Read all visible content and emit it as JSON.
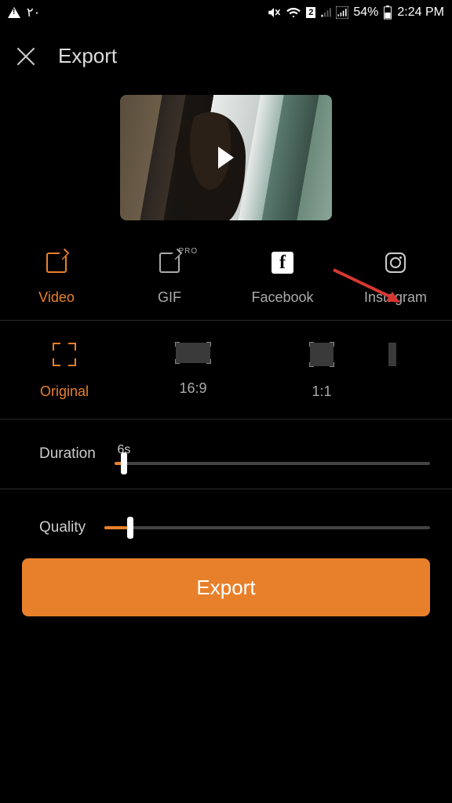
{
  "status": {
    "left_text": "٢٠",
    "battery": "54%",
    "time": "2:24 PM",
    "sim": "2"
  },
  "header": {
    "title": "Export"
  },
  "share": {
    "video": "Video",
    "gif": "GIF",
    "gif_badge": "PRO",
    "facebook": "Facebook",
    "instagram": "Instagram"
  },
  "aspect": {
    "original": "Original",
    "r169": "16:9",
    "r11": "1:1"
  },
  "duration": {
    "label": "Duration",
    "value_text": "6s",
    "percent": 3
  },
  "quality": {
    "label": "Quality",
    "percent": 8
  },
  "export_button": "Export"
}
